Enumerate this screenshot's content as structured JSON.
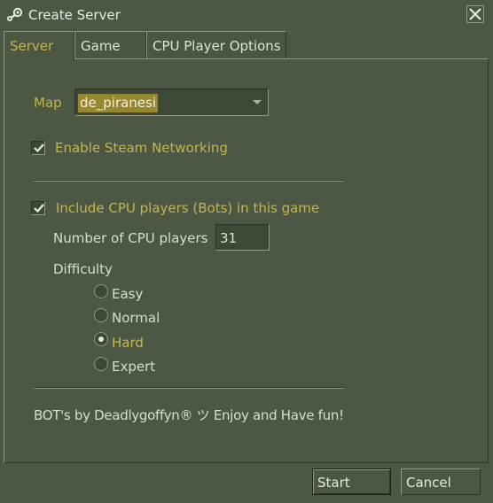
{
  "window": {
    "title": "Create Server",
    "app_icon": "steam-icon",
    "close_icon": "close-icon"
  },
  "tabs": [
    {
      "label": "Server",
      "active": true
    },
    {
      "label": "Game",
      "active": false
    },
    {
      "label": "CPU Player Options",
      "active": false
    }
  ],
  "server": {
    "map_label": "Map",
    "map_value": "de_piranesi",
    "steam_networking": {
      "label": "Enable Steam Networking",
      "checked": true
    }
  },
  "bots": {
    "include": {
      "label": "Include CPU players (Bots) in this game",
      "checked": true
    },
    "count_label": "Number of CPU players",
    "count_value": "31",
    "difficulty_label": "Difficulty",
    "difficulty_options": [
      {
        "label": "Easy",
        "selected": false
      },
      {
        "label": "Normal",
        "selected": false
      },
      {
        "label": "Hard",
        "selected": true
      },
      {
        "label": "Expert",
        "selected": false
      }
    ],
    "credit": "BOT's by Deadlygoffyn® ツ  Enjoy and Have fun!"
  },
  "buttons": {
    "start": "Start",
    "cancel": "Cancel"
  },
  "colors": {
    "background": "#4c5844",
    "highlight": "#c4b550",
    "selection": "#958830"
  }
}
